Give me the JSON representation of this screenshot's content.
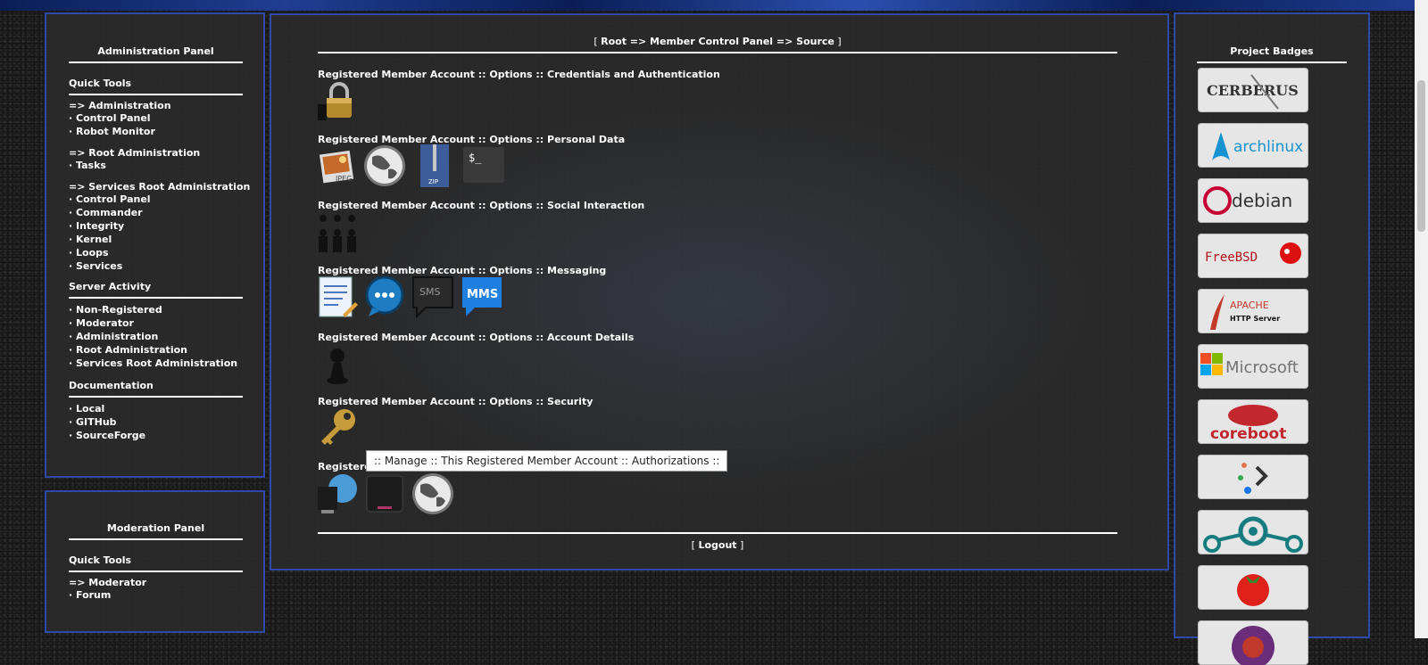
{
  "admin_panel": {
    "title": "Administration Panel",
    "quick_tools": "Quick Tools",
    "items": [
      "=> Administration",
      "· Control Panel",
      "· Robot Monitor",
      "=> Root Administration",
      "· Tasks",
      "=> Services Root Administration",
      "· Control Panel",
      "· Commander",
      "· Integrity",
      "· Kernel",
      "· Loops",
      "· Services"
    ],
    "server_activity": "Server Activity",
    "activity_items": [
      "· Non-Registered",
      "· Moderator",
      "· Administration",
      "· Root Administration",
      "· Services Root Administration"
    ],
    "documentation": "Documentation",
    "doc_items": [
      "· Local",
      "· GITHub",
      "· SourceForge"
    ]
  },
  "mod_panel": {
    "title": "Moderation Panel",
    "quick_tools": "Quick Tools",
    "items": [
      "=> Moderator",
      "· Forum"
    ]
  },
  "center": {
    "breadcrumb_open": "[ ",
    "breadcrumb_text": "Root => Member Control Panel => Source",
    "breadcrumb_close": " ]",
    "sections": [
      "Registered Member Account :: Options :: Credentials and Authentication",
      "Registered Member Account :: Options :: Personal Data",
      "Registered Member Account :: Options :: Social Interaction",
      "Registered Member Account :: Options :: Messaging",
      "Registered Member Account :: Options :: Account Details",
      "Registered Member Account :: Options :: Security",
      "Registered Member Account :: Options :: Logs"
    ],
    "icons": {
      "credentials": [
        "lock-icon"
      ],
      "personal": [
        "jpeg-image-icon",
        "globe-icon",
        "zip-archive-icon",
        "terminal-icon"
      ],
      "social": [
        "audience-icon"
      ],
      "messaging": [
        "note-edit-icon",
        "chat-bubble-icon",
        "sms-icon",
        "mms-icon"
      ],
      "account": [
        "user-silhouette-icon"
      ],
      "security": [
        "key-icon"
      ],
      "logs": [
        "computer-globe-icon",
        "hard-drive-icon",
        "globe-icon"
      ]
    },
    "zip_label": "ZIP",
    "terminal_label": "$_",
    "sms_label": "SMS",
    "mms_label": "MMS",
    "jpeg_label": "JPEG",
    "tooltip": ":: Manage :: This Registered Member Account :: Authorizations ::",
    "logout_open": "[ ",
    "logout_text": "Logout",
    "logout_close": " ]"
  },
  "badges": {
    "title": "Project Badges",
    "items": [
      {
        "name": "cerberus-badge",
        "text": "CERBERUS"
      },
      {
        "name": "archlinux-badge",
        "text": "archlinux"
      },
      {
        "name": "debian-badge",
        "text": "debian"
      },
      {
        "name": "freebsd-badge",
        "text": "FreeBSD"
      },
      {
        "name": "apache-badge",
        "text": "APACHE",
        "subtext": "HTTP Server"
      },
      {
        "name": "microsoft-badge",
        "text": "Microsoft"
      },
      {
        "name": "coreboot-badge",
        "text": "coreboot"
      },
      {
        "name": "prompt-badge",
        "text": ""
      },
      {
        "name": "lineage-badge",
        "text": ""
      },
      {
        "name": "tomato-badge",
        "text": ""
      },
      {
        "name": "purple-badge",
        "text": ""
      }
    ]
  },
  "colors": {
    "panel_border": "#2d4aa8",
    "panel_bg": "#2a2a2a"
  }
}
